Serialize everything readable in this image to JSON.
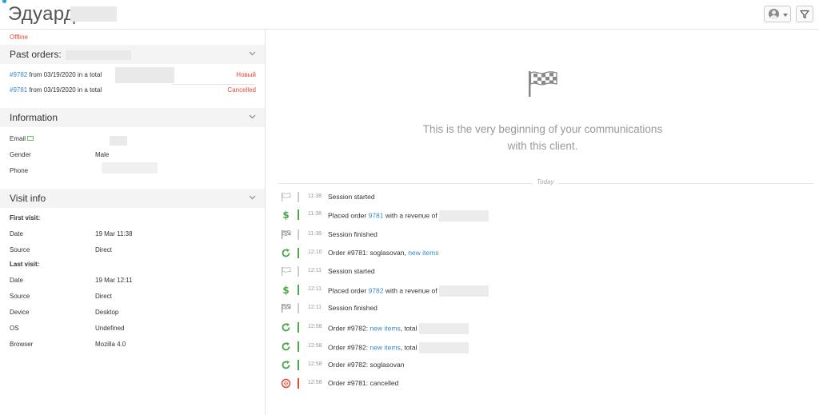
{
  "header": {
    "client_name": "Эдуард"
  },
  "sidebar": {
    "status": "Offline",
    "past_orders": {
      "title": "Past orders:",
      "orders": [
        {
          "id": "#9782",
          "text": " from 03/19/2020 in a total",
          "status": "Новый"
        },
        {
          "id": "#9781",
          "text": " from 03/19/2020 in a total",
          "status": "Cancelled"
        }
      ]
    },
    "information": {
      "title": "Information",
      "rows": [
        {
          "key": "Email",
          "value": ""
        },
        {
          "key": "Gender",
          "value": "Male"
        },
        {
          "key": "Phone",
          "value": ""
        }
      ]
    },
    "visit_info": {
      "title": "Visit info",
      "first_visit_label": "First visit:",
      "first_visit": [
        {
          "key": "Date",
          "value": "19 Mar 11:38"
        },
        {
          "key": "Source",
          "value": "Direct"
        }
      ],
      "last_visit_label": "Last visit:",
      "last_visit": [
        {
          "key": "Date",
          "value": "19 Mar 12:11"
        },
        {
          "key": "Source",
          "value": "Direct"
        },
        {
          "key": "Device",
          "value": "Desktop"
        },
        {
          "key": "OS",
          "value": "Undefined"
        },
        {
          "key": "Browser",
          "value": "Mozilla 4.0"
        }
      ]
    }
  },
  "main": {
    "empty_text_line1": "This is the very beginning of your communications",
    "empty_text_line2": "with this client.",
    "today_label": "Today",
    "events": [
      {
        "time": "11:38",
        "icon": "flag-outline-icon",
        "pre": "Session started",
        "link": "",
        "post": ""
      },
      {
        "time": "11:38",
        "icon": "dollar-icon",
        "pre": "Placed order ",
        "link": "9781",
        "post": " with a revenue of"
      },
      {
        "time": "11:38",
        "icon": "flag-checkered-icon",
        "pre": "Session finished",
        "link": "",
        "post": ""
      },
      {
        "time": "12:10",
        "icon": "refresh-icon",
        "pre": "Order #9781: soglasovan, ",
        "link": "new items",
        "post": ""
      },
      {
        "time": "12:11",
        "icon": "flag-outline-icon",
        "pre": "Session started",
        "link": "",
        "post": ""
      },
      {
        "time": "12:11",
        "icon": "dollar-icon",
        "pre": "Placed order ",
        "link": "9782",
        "post": " with a revenue of"
      },
      {
        "time": "12:11",
        "icon": "flag-checkered-icon",
        "pre": "Session finished",
        "link": "",
        "post": ""
      },
      {
        "time": "12:58",
        "icon": "refresh-icon",
        "pre": "Order #9782: ",
        "link": "new items",
        "post": ", total"
      },
      {
        "time": "12:58",
        "icon": "refresh-icon",
        "pre": "Order #9782: ",
        "link": "new items",
        "post": ", total"
      },
      {
        "time": "12:58",
        "icon": "refresh-icon",
        "pre": "Order #9782: soglasovan",
        "link": "",
        "post": ""
      },
      {
        "time": "12:58",
        "icon": "cancel-circle-icon",
        "pre": "Order #9781: cancelled",
        "link": "",
        "post": ""
      }
    ]
  },
  "colors": {
    "accent_blue": "#3a87c8",
    "status_red": "#e5493a",
    "success_green": "#4aa84a",
    "muted_gray": "#999999"
  }
}
